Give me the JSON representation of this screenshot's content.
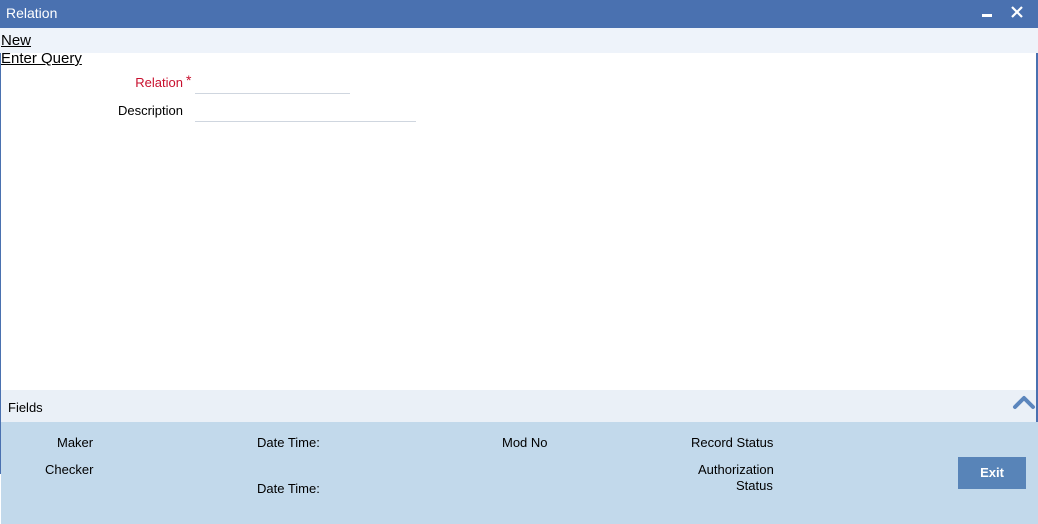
{
  "window": {
    "title": "Relation"
  },
  "toolbar": {
    "new_label": "New",
    "query_label": "Enter Query"
  },
  "form": {
    "relation_label": "Relation",
    "required_marker": "*",
    "relation_value": "",
    "description_label": "Description",
    "description_value": ""
  },
  "fields_bar": {
    "label": "Fields"
  },
  "audit": {
    "maker": "Maker",
    "maker_datetime": "Date Time:",
    "mod_no": "Mod No",
    "record_status": "Record Status",
    "checker": "Checker",
    "checker_datetime": "Date Time:",
    "auth_status_line1": "Authorization",
    "auth_status_line2": "Status"
  },
  "buttons": {
    "exit_label": "Exit"
  },
  "icons": {
    "minimize": "minimize-icon",
    "close": "close-icon",
    "collapse": "chevron-up-icon"
  },
  "colors": {
    "titlebar": "#4a71b0",
    "footer": "#c2d9eb",
    "button": "#5884b8",
    "required": "#c8102e"
  }
}
